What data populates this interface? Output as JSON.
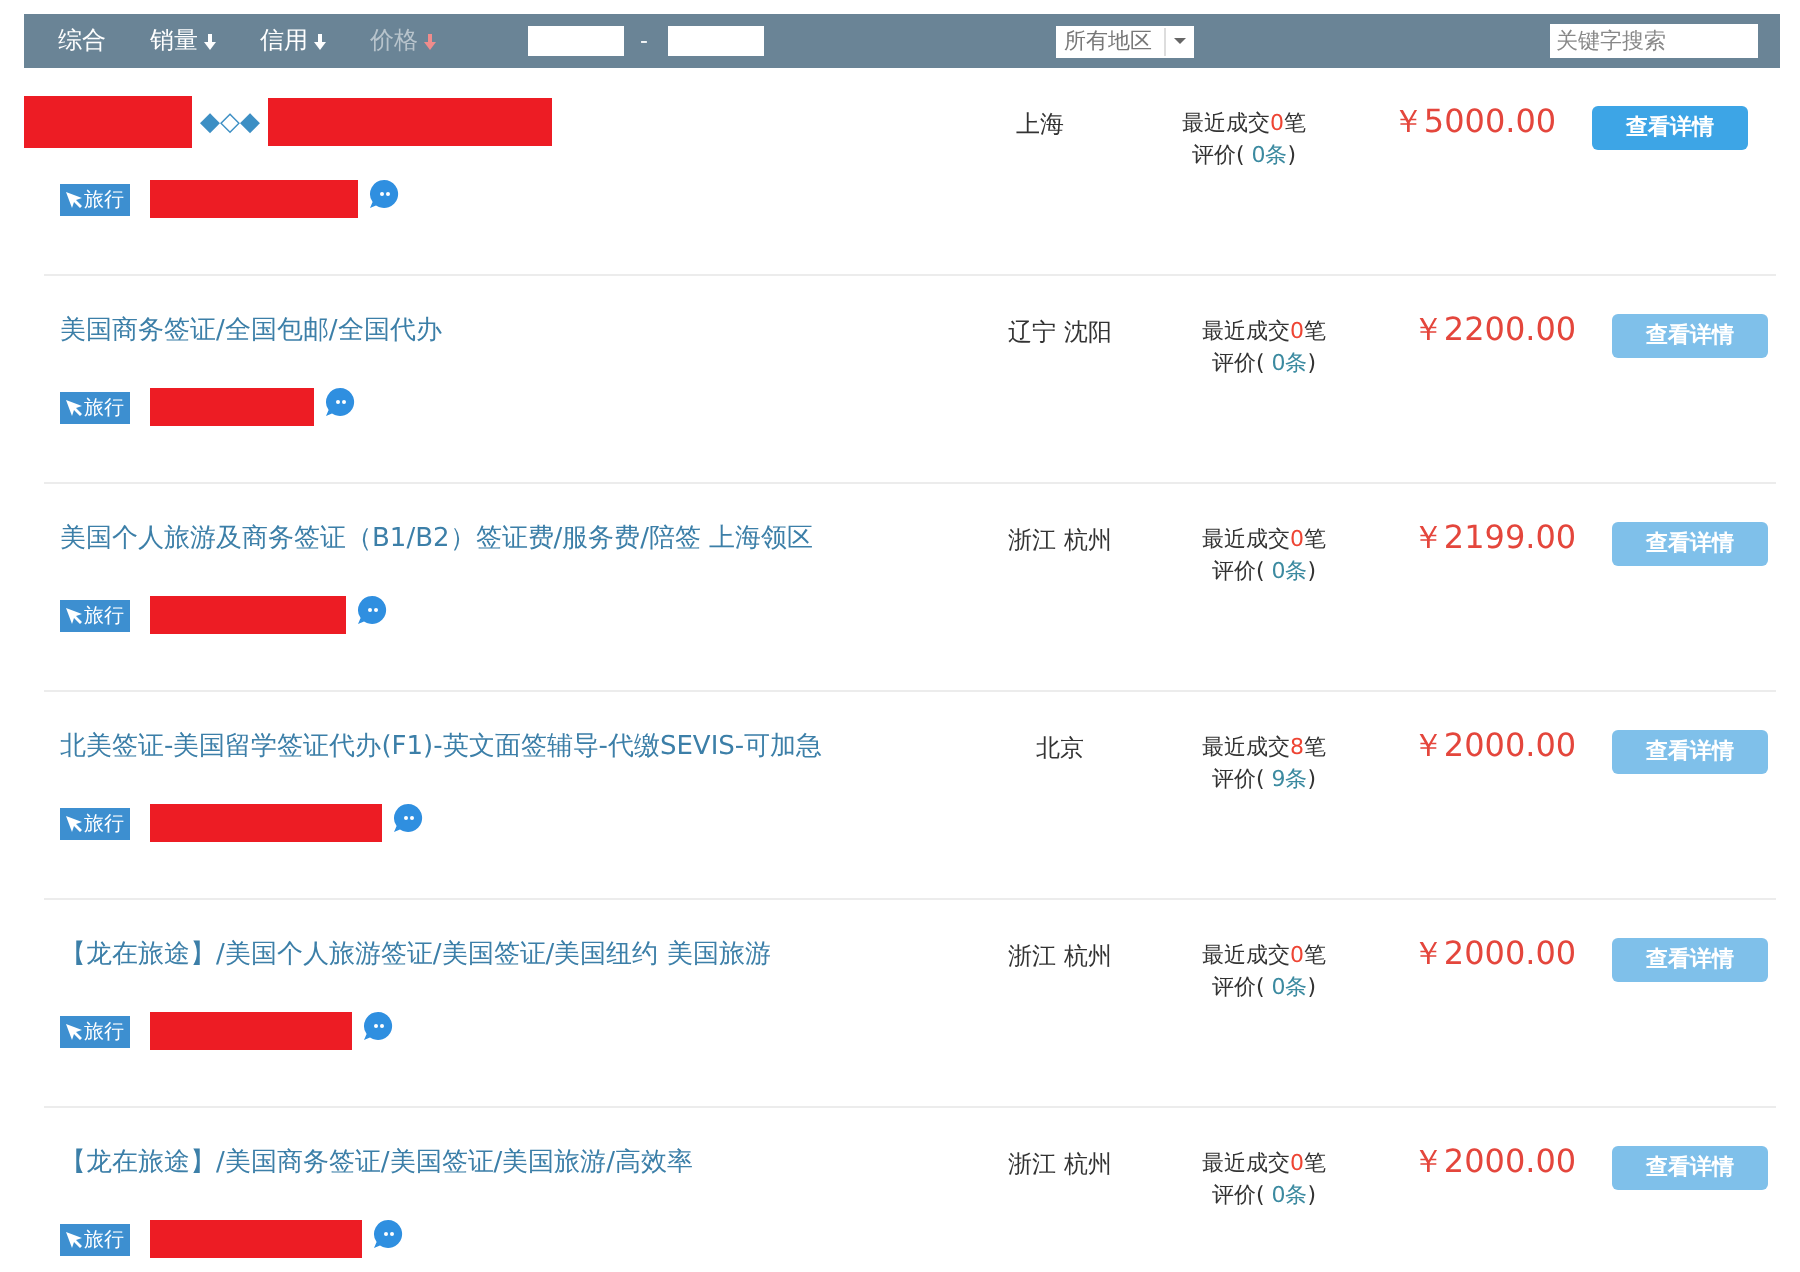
{
  "toolbar": {
    "sort_options": [
      {
        "label": "综合",
        "arrow": false,
        "selected": false
      },
      {
        "label": "销量",
        "arrow": true,
        "selected": false
      },
      {
        "label": "信用",
        "arrow": true,
        "selected": false
      },
      {
        "label": "价格",
        "arrow": true,
        "selected": true
      }
    ],
    "price_range_separator": "-",
    "region_select": {
      "value": "所有地区"
    },
    "search": {
      "placeholder": "关键字搜索"
    }
  },
  "listings": [
    {
      "kind": "redacted-title",
      "title": "◆◇◆",
      "tag": "旅行",
      "location": "上海",
      "sales_prefix": "最近成交",
      "sales_count": "0",
      "sales_suffix": "笔",
      "reviews_prefix": "评价(",
      "reviews_count": "0条",
      "reviews_suffix": ")",
      "price": "￥5000.00",
      "button": "查看详情",
      "highlighted": true
    },
    {
      "kind": "plain",
      "title": "美国商务签证/全国包邮/全国代办",
      "tag": "旅行",
      "location": "辽宁 沈阳",
      "sales_prefix": "最近成交",
      "sales_count": "0",
      "sales_suffix": "笔",
      "reviews_prefix": "评价(",
      "reviews_count": "0条",
      "reviews_suffix": ")",
      "price": "￥2200.00",
      "button": "查看详情",
      "highlighted": false
    },
    {
      "kind": "plain",
      "title": "美国个人旅游及商务签证（B1/B2）签证费/服务费/陪签 上海领区",
      "tag": "旅行",
      "location": "浙江 杭州",
      "sales_prefix": "最近成交",
      "sales_count": "0",
      "sales_suffix": "笔",
      "reviews_prefix": "评价(",
      "reviews_count": "0条",
      "reviews_suffix": ")",
      "price": "￥2199.00",
      "button": "查看详情",
      "highlighted": false
    },
    {
      "kind": "plain",
      "title": "北美签证-美国留学签证代办(F1)-英文面签辅导-代缴SEVIS-可加急",
      "tag": "旅行",
      "location": "北京",
      "sales_prefix": "最近成交",
      "sales_count": "8",
      "sales_suffix": "笔",
      "reviews_prefix": "评价(",
      "reviews_count": "9条",
      "reviews_suffix": ")",
      "price": "￥2000.00",
      "button": "查看详情",
      "highlighted": false
    },
    {
      "kind": "plain",
      "title": "【龙在旅途】/美国个人旅游签证/美国签证/美国纽约 美国旅游",
      "tag": "旅行",
      "location": "浙江 杭州",
      "sales_prefix": "最近成交",
      "sales_count": "0",
      "sales_suffix": "笔",
      "reviews_prefix": "评价(",
      "reviews_count": "0条",
      "reviews_suffix": ")",
      "price": "￥2000.00",
      "button": "查看详情",
      "highlighted": false
    },
    {
      "kind": "plain",
      "title": "【龙在旅途】/美国商务签证/美国签证/美国旅游/高效率",
      "tag": "旅行",
      "location": "浙江 杭州",
      "sales_prefix": "最近成交",
      "sales_count": "0",
      "sales_suffix": "笔",
      "reviews_prefix": "评价(",
      "reviews_count": "0条",
      "reviews_suffix": ")",
      "price": "￥2000.00",
      "button": "查看详情",
      "highlighted": false
    }
  ]
}
